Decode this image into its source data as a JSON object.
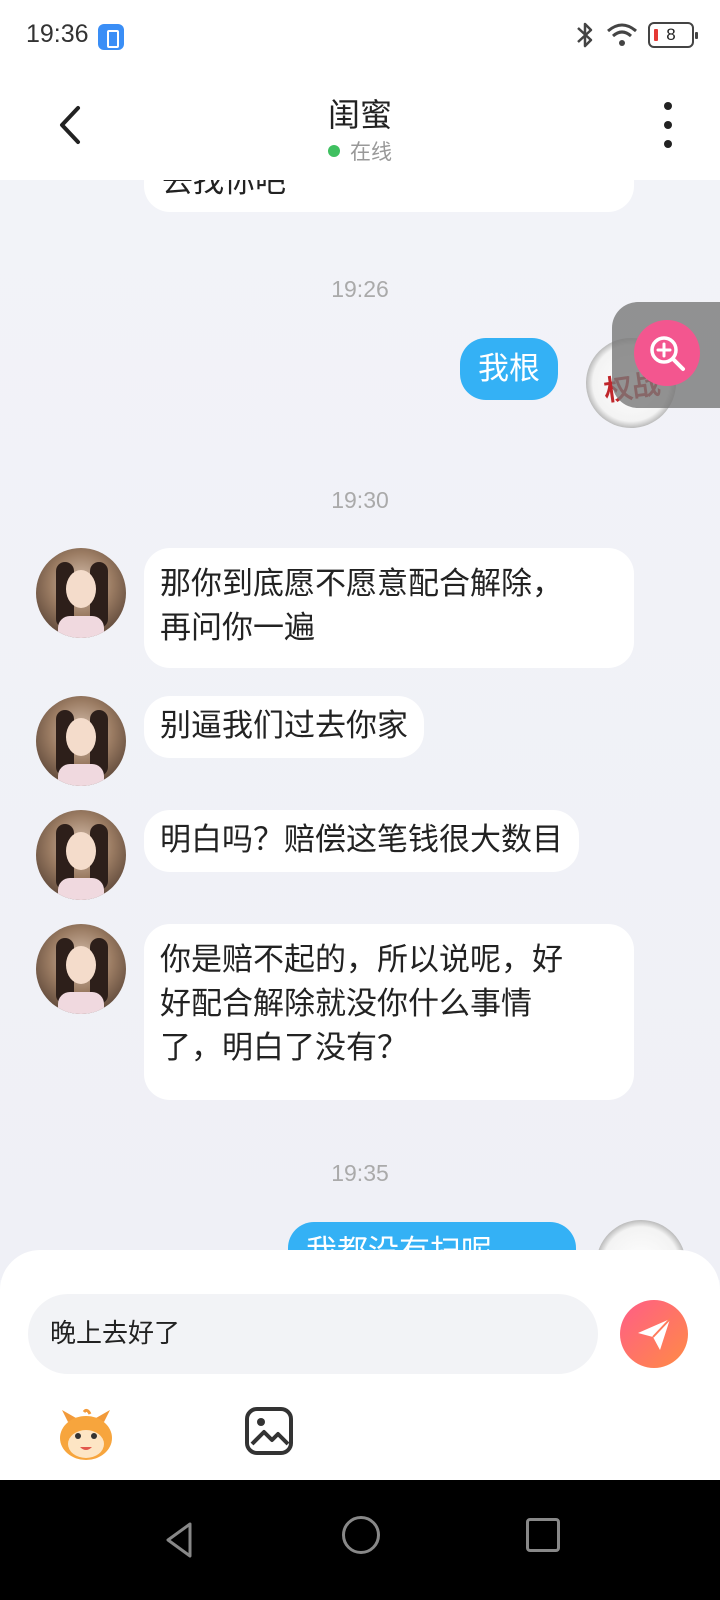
{
  "status_bar": {
    "time": "19:36",
    "battery": "8"
  },
  "header": {
    "title": "闺蜜",
    "status": "在线",
    "status_color": "#3fc060"
  },
  "chat": {
    "partial_top_message": "去找你吧",
    "time_1926": "19:26",
    "my_message_1": "我根",
    "time_1930": "19:30",
    "messages_1930": [
      {
        "line1": "那你到底愿不愿意配合解除，",
        "line2": "再问你一遍"
      },
      {
        "line1": "别逼我们过去你家"
      },
      {
        "line1": "明白吗？赔偿这笔钱很大数目"
      },
      {
        "line1": "你是赔不起的，所以说呢，好",
        "line2": "好配合解除就没你什么事情",
        "line3": "了，明白了没有？"
      }
    ],
    "time_1935": "19:35",
    "my_message_partial": "我都没有扫呢"
  },
  "input": {
    "value": "晚上去好了"
  },
  "colors": {
    "my_bubble": "#34b1f5",
    "send_gradient_start": "#ff5d87",
    "send_gradient_end": "#ff8b45"
  },
  "icons": {
    "back": "chevron-left-icon",
    "more": "more-vertical-icon",
    "zoom": "zoom-in-icon",
    "send": "send-icon",
    "emoji": "emoji-icon",
    "image": "image-icon"
  }
}
